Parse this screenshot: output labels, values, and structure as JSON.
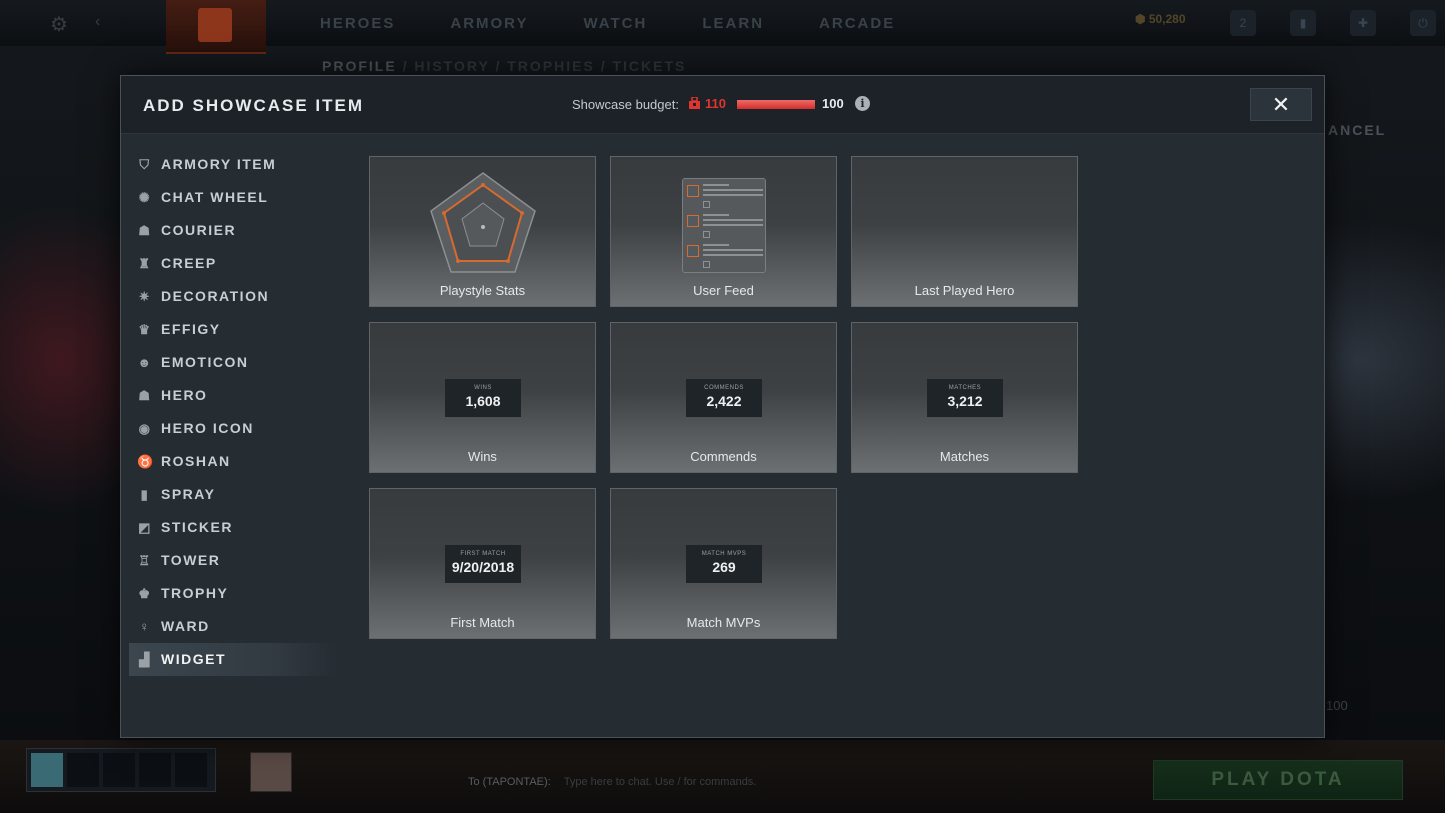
{
  "background": {
    "nav": [
      "HEROES",
      "ARMORY",
      "WATCH",
      "LEARN",
      "ARCADE"
    ],
    "currency": "50,280",
    "badge_count": "2",
    "subnav": [
      "PROFILE",
      "HISTORY",
      "TROPHIES",
      "TICKETS"
    ],
    "side_cancel": "ANCEL",
    "side_value": "100",
    "chat_target": "To (TAPONTAE):",
    "chat_placeholder": "Type here to chat. Use / for commands.",
    "play_button": "PLAY DOTA"
  },
  "modal": {
    "title": "ADD SHOWCASE ITEM",
    "budget": {
      "label": "Showcase budget:",
      "current": "110",
      "max": "100",
      "fill_fraction": 1.0,
      "info_glyph": "i"
    },
    "close_glyph": "✕",
    "categories": [
      {
        "label": "ARMORY ITEM",
        "icon": "armory-icon",
        "glyph": "⛉"
      },
      {
        "label": "CHAT WHEEL",
        "icon": "chat-wheel-icon",
        "glyph": "✺"
      },
      {
        "label": "COURIER",
        "icon": "courier-icon",
        "glyph": "☗"
      },
      {
        "label": "CREEP",
        "icon": "creep-icon",
        "glyph": "♜"
      },
      {
        "label": "DECORATION",
        "icon": "decoration-icon",
        "glyph": "✷"
      },
      {
        "label": "EFFIGY",
        "icon": "effigy-icon",
        "glyph": "♛"
      },
      {
        "label": "EMOTICON",
        "icon": "emoticon-icon",
        "glyph": "☻"
      },
      {
        "label": "HERO",
        "icon": "hero-icon",
        "glyph": "☗"
      },
      {
        "label": "HERO ICON",
        "icon": "hero-icon-icon",
        "glyph": "◉"
      },
      {
        "label": "ROSHAN",
        "icon": "roshan-icon",
        "glyph": "♉"
      },
      {
        "label": "SPRAY",
        "icon": "spray-icon",
        "glyph": "▮"
      },
      {
        "label": "STICKER",
        "icon": "sticker-icon",
        "glyph": "◩"
      },
      {
        "label": "TOWER",
        "icon": "tower-icon",
        "glyph": "♖"
      },
      {
        "label": "TROPHY",
        "icon": "trophy-icon",
        "glyph": "♚"
      },
      {
        "label": "WARD",
        "icon": "ward-icon",
        "glyph": "♀"
      },
      {
        "label": "WIDGET",
        "icon": "widget-icon",
        "glyph": "▟",
        "active": true
      }
    ],
    "items": {
      "playstyle": {
        "label": "Playstyle Stats"
      },
      "feed": {
        "label": "User Feed"
      },
      "last_hero": {
        "label": "Last Played Hero"
      },
      "wins": {
        "label": "Wins",
        "caption": "WINS",
        "value": "1,608"
      },
      "commends": {
        "label": "Commends",
        "caption": "COMMENDS",
        "value": "2,422"
      },
      "matches": {
        "label": "Matches",
        "caption": "MATCHES",
        "value": "3,212"
      },
      "first_match": {
        "label": "First Match",
        "caption": "FIRST MATCH",
        "value": "9/20/2018"
      },
      "mvps": {
        "label": "Match MVPs",
        "caption": "MATCH MVPS",
        "value": "269"
      }
    }
  },
  "colors": {
    "budget_over": "#e0352e",
    "accent_orange": "#d66a2f",
    "modal_bg": "#252c32"
  }
}
